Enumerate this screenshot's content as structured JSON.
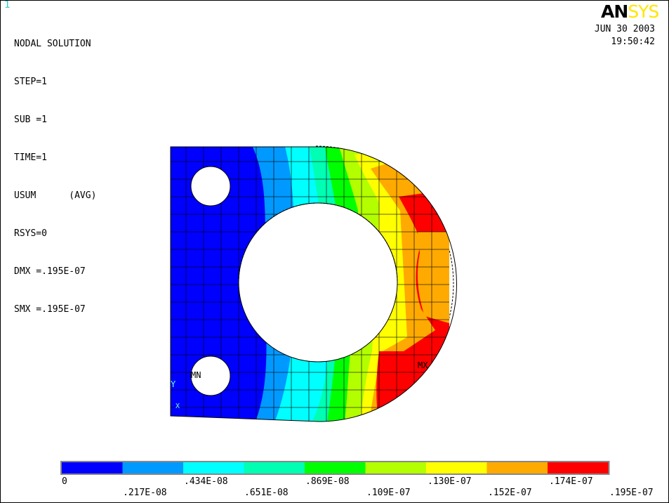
{
  "window_number": "1",
  "header": {
    "title": "NODAL SOLUTION",
    "lines": [
      "STEP=1",
      "SUB =1",
      "TIME=1",
      "USUM      (AVG)",
      "RSYS=0",
      "DMX =.195E-07",
      "SMX =.195E-07"
    ]
  },
  "logo": {
    "part1": "AN",
    "part2": "SYS"
  },
  "date": "JUN 30 2003",
  "time": "19:50:42",
  "markers": {
    "min": "MN",
    "max": "MX",
    "axis_y": "Y",
    "axis_x": "X"
  },
  "legend": {
    "colors": [
      "#0000ff",
      "#0099ff",
      "#00ffff",
      "#00ffb3",
      "#00ff00",
      "#b3ff00",
      "#ffff00",
      "#ffaa00",
      "#ff0000"
    ],
    "labels_top": [
      "0",
      ".434E-08",
      ".869E-08",
      ".130E-07",
      ".174E-07"
    ],
    "labels_bottom": [
      ".217E-08",
      ".651E-08",
      ".109E-07",
      ".152E-07",
      ".195E-07"
    ]
  }
}
